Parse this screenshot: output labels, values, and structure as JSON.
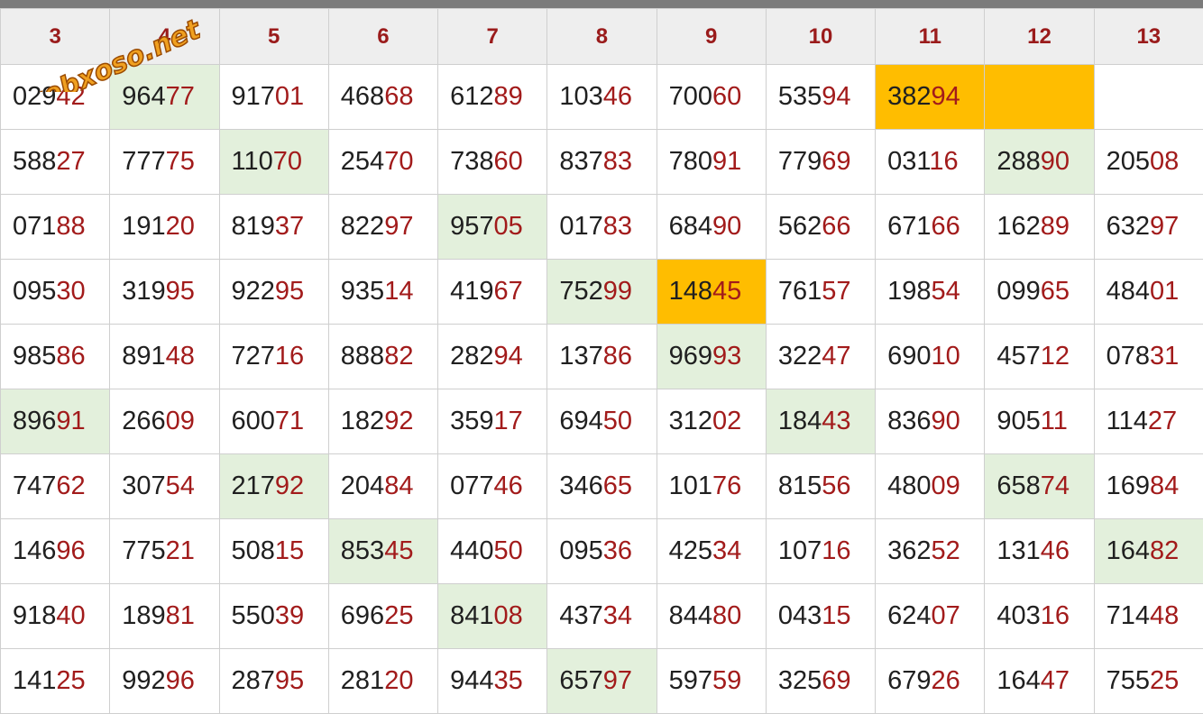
{
  "columns": [
    "3",
    "4",
    "5",
    "6",
    "7",
    "8",
    "9",
    "10",
    "11",
    "12",
    "13"
  ],
  "watermark": "webxoso.net",
  "rows": [
    [
      {
        "head": "029",
        "tail": "42"
      },
      {
        "head": "964",
        "tail": "77",
        "hl": "green"
      },
      {
        "head": "917",
        "tail": "01"
      },
      {
        "head": "468",
        "tail": "68"
      },
      {
        "head": "612",
        "tail": "89"
      },
      {
        "head": "103",
        "tail": "46"
      },
      {
        "head": "700",
        "tail": "60"
      },
      {
        "head": "535",
        "tail": "94"
      },
      {
        "head": "382",
        "tail": "94",
        "hl": "orange"
      },
      {
        "head": "",
        "tail": "",
        "hl": "orange"
      },
      {
        "head": "",
        "tail": ""
      }
    ],
    [
      {
        "head": "588",
        "tail": "27"
      },
      {
        "head": "777",
        "tail": "75"
      },
      {
        "head": "110",
        "tail": "70",
        "hl": "green"
      },
      {
        "head": "254",
        "tail": "70"
      },
      {
        "head": "738",
        "tail": "60"
      },
      {
        "head": "837",
        "tail": "83"
      },
      {
        "head": "780",
        "tail": "91"
      },
      {
        "head": "779",
        "tail": "69"
      },
      {
        "head": "031",
        "tail": "16"
      },
      {
        "head": "288",
        "tail": "90",
        "hl": "green"
      },
      {
        "head": "205",
        "tail": "08"
      }
    ],
    [
      {
        "head": "071",
        "tail": "88"
      },
      {
        "head": "191",
        "tail": "20"
      },
      {
        "head": "819",
        "tail": "37"
      },
      {
        "head": "822",
        "tail": "97"
      },
      {
        "head": "957",
        "tail": "05",
        "hl": "green"
      },
      {
        "head": "017",
        "tail": "83"
      },
      {
        "head": "684",
        "tail": "90"
      },
      {
        "head": "562",
        "tail": "66"
      },
      {
        "head": "671",
        "tail": "66"
      },
      {
        "head": "162",
        "tail": "89"
      },
      {
        "head": "632",
        "tail": "97"
      }
    ],
    [
      {
        "head": "095",
        "tail": "30"
      },
      {
        "head": "319",
        "tail": "95"
      },
      {
        "head": "922",
        "tail": "95"
      },
      {
        "head": "935",
        "tail": "14"
      },
      {
        "head": "419",
        "tail": "67"
      },
      {
        "head": "752",
        "tail": "99",
        "hl": "green"
      },
      {
        "head": "148",
        "tail": "45",
        "hl": "orange"
      },
      {
        "head": "761",
        "tail": "57"
      },
      {
        "head": "198",
        "tail": "54"
      },
      {
        "head": "099",
        "tail": "65"
      },
      {
        "head": "484",
        "tail": "01"
      }
    ],
    [
      {
        "head": "985",
        "tail": "86"
      },
      {
        "head": "891",
        "tail": "48"
      },
      {
        "head": "727",
        "tail": "16"
      },
      {
        "head": "888",
        "tail": "82"
      },
      {
        "head": "282",
        "tail": "94"
      },
      {
        "head": "137",
        "tail": "86"
      },
      {
        "head": "969",
        "tail": "93",
        "hl": "green"
      },
      {
        "head": "322",
        "tail": "47"
      },
      {
        "head": "690",
        "tail": "10"
      },
      {
        "head": "457",
        "tail": "12"
      },
      {
        "head": "078",
        "tail": "31"
      }
    ],
    [
      {
        "head": "896",
        "tail": "91",
        "hl": "green"
      },
      {
        "head": "266",
        "tail": "09"
      },
      {
        "head": "600",
        "tail": "71"
      },
      {
        "head": "182",
        "tail": "92"
      },
      {
        "head": "359",
        "tail": "17"
      },
      {
        "head": "694",
        "tail": "50"
      },
      {
        "head": "312",
        "tail": "02"
      },
      {
        "head": "184",
        "tail": "43",
        "hl": "green"
      },
      {
        "head": "836",
        "tail": "90"
      },
      {
        "head": "905",
        "tail": "11"
      },
      {
        "head": "114",
        "tail": "27"
      }
    ],
    [
      {
        "head": "747",
        "tail": "62"
      },
      {
        "head": "307",
        "tail": "54"
      },
      {
        "head": "217",
        "tail": "92",
        "hl": "green"
      },
      {
        "head": "204",
        "tail": "84"
      },
      {
        "head": "077",
        "tail": "46"
      },
      {
        "head": "346",
        "tail": "65"
      },
      {
        "head": "101",
        "tail": "76"
      },
      {
        "head": "815",
        "tail": "56"
      },
      {
        "head": "480",
        "tail": "09"
      },
      {
        "head": "658",
        "tail": "74",
        "hl": "green"
      },
      {
        "head": "169",
        "tail": "84"
      }
    ],
    [
      {
        "head": "146",
        "tail": "96"
      },
      {
        "head": "775",
        "tail": "21"
      },
      {
        "head": "508",
        "tail": "15"
      },
      {
        "head": "853",
        "tail": "45",
        "hl": "green"
      },
      {
        "head": "440",
        "tail": "50"
      },
      {
        "head": "095",
        "tail": "36"
      },
      {
        "head": "425",
        "tail": "34"
      },
      {
        "head": "107",
        "tail": "16"
      },
      {
        "head": "362",
        "tail": "52"
      },
      {
        "head": "131",
        "tail": "46"
      },
      {
        "head": "164",
        "tail": "82",
        "hl": "green"
      }
    ],
    [
      {
        "head": "918",
        "tail": "40"
      },
      {
        "head": "189",
        "tail": "81"
      },
      {
        "head": "550",
        "tail": "39"
      },
      {
        "head": "696",
        "tail": "25"
      },
      {
        "head": "841",
        "tail": "08",
        "hl": "green"
      },
      {
        "head": "437",
        "tail": "34"
      },
      {
        "head": "844",
        "tail": "80"
      },
      {
        "head": "043",
        "tail": "15"
      },
      {
        "head": "624",
        "tail": "07"
      },
      {
        "head": "403",
        "tail": "16"
      },
      {
        "head": "714",
        "tail": "48"
      }
    ],
    [
      {
        "head": "141",
        "tail": "25"
      },
      {
        "head": "992",
        "tail": "96"
      },
      {
        "head": "287",
        "tail": "95"
      },
      {
        "head": "281",
        "tail": "20"
      },
      {
        "head": "944",
        "tail": "35"
      },
      {
        "head": "657",
        "tail": "97",
        "hl": "green"
      },
      {
        "head": "597",
        "tail": "59"
      },
      {
        "head": "325",
        "tail": "69"
      },
      {
        "head": "679",
        "tail": "26"
      },
      {
        "head": "164",
        "tail": "47"
      },
      {
        "head": "755",
        "tail": "25"
      }
    ]
  ]
}
